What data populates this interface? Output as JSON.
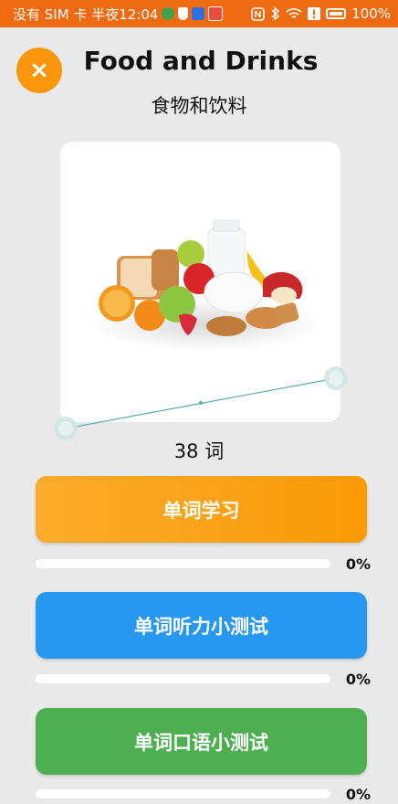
{
  "status_bar": {
    "left_text": "没有 SIM 卡 半夜12:04",
    "battery": "100%",
    "icons": [
      "app-icon-green",
      "shield-icon",
      "app-icon-blue",
      "app-icon-red",
      "nfc-icon",
      "bluetooth-icon",
      "wifi-icon",
      "alert-icon",
      "battery-icon"
    ]
  },
  "header": {
    "close_icon": "close-icon",
    "title": "Food and Drinks",
    "subtitle": "食物和饮料"
  },
  "card": {
    "image": "food-and-drinks-illustration"
  },
  "word_count": "38 词",
  "actions": [
    {
      "label": "单词学习",
      "progress": 0,
      "progress_label": "0%",
      "color": "#fb9a05"
    },
    {
      "label": "单词听力小测试",
      "progress": 0,
      "progress_label": "0%",
      "color": "#2797f0"
    },
    {
      "label": "单词口语小测试",
      "progress": 0,
      "progress_label": "0%",
      "color": "#4daf52"
    }
  ],
  "colors": {
    "status_bar": "#f06a12",
    "accent": "#f9960c",
    "background": "#e9e9e9"
  }
}
